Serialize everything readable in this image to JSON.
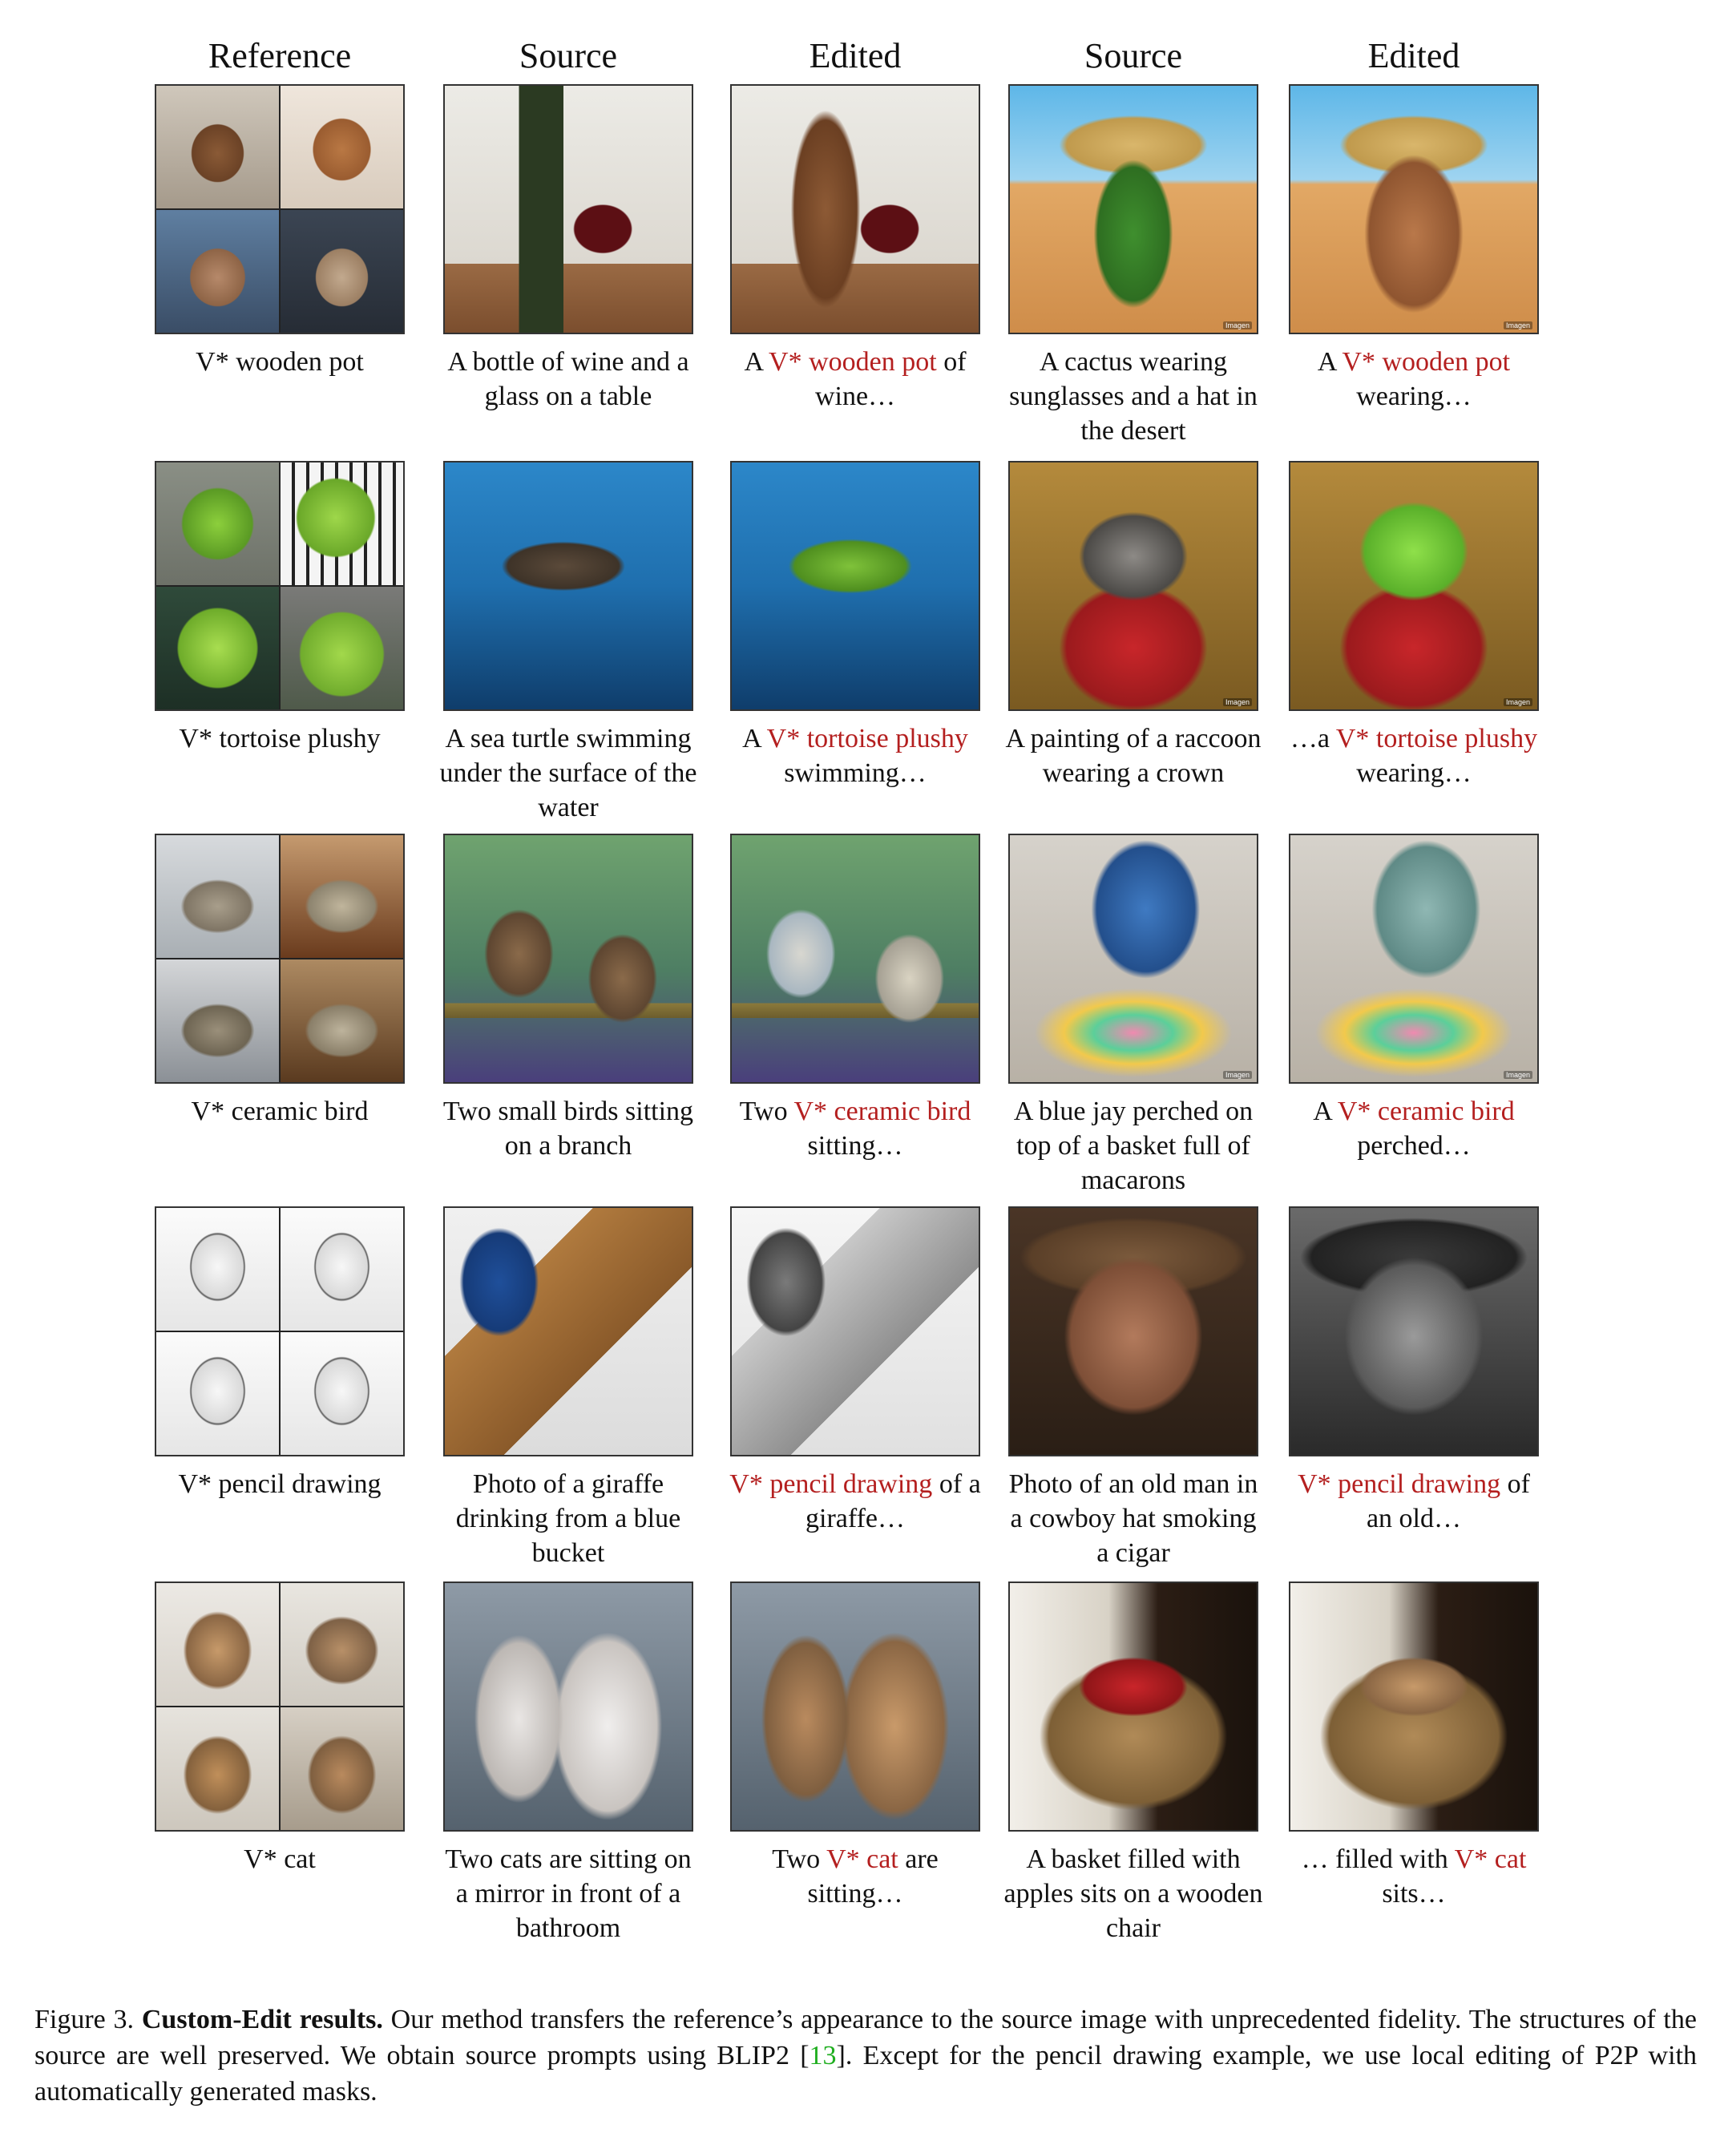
{
  "headers": {
    "reference": "Reference",
    "source_1": "Source",
    "edited_1": "Edited",
    "source_2": "Source",
    "edited_2": "Edited"
  },
  "watermark": "Imagen",
  "rows": [
    {
      "reference": "V* wooden pot",
      "source_1": "A bottle of wine and a glass on a table",
      "edited_1": {
        "pre": "A ",
        "concept": "V* wooden pot",
        "post": " of wine…"
      },
      "source_2": "A cactus wearing sunglasses and a hat in the desert",
      "edited_2": {
        "pre": "A ",
        "concept": "V* wooden pot",
        "post": " wearing…"
      }
    },
    {
      "reference": "V* tortoise plushy",
      "source_1": "A sea turtle swimming under the surface of the water",
      "edited_1": {
        "pre": "A ",
        "concept": "V* tortoise plushy",
        "post": " swimming…"
      },
      "source_2": "A painting of a raccoon wearing a crown",
      "edited_2": {
        "pre": "…a ",
        "concept": "V* tortoise plushy",
        "post": " wearing…"
      }
    },
    {
      "reference": "V* ceramic bird",
      "source_1": "Two small birds sitting on a branch",
      "edited_1": {
        "pre": "Two ",
        "concept": "V* ceramic bird",
        "post": " sitting…"
      },
      "source_2": "A blue jay perched on top of a basket full of macarons",
      "edited_2": {
        "pre": "A ",
        "concept": "V* ceramic bird",
        "post": " perched…"
      }
    },
    {
      "reference": "V* pencil drawing",
      "source_1": "Photo of a giraffe drinking from a blue bucket",
      "edited_1": {
        "pre": "",
        "concept": "V* pencil drawing",
        "post": " of a giraffe…"
      },
      "source_2": "Photo of an old man in a cowboy hat smoking a cigar",
      "edited_2": {
        "pre": "",
        "concept": "V* pencil drawing",
        "post": " of an old…"
      }
    },
    {
      "reference": "V* cat",
      "source_1": "Two cats are sitting on a mirror in front of a bathroom",
      "edited_1": {
        "pre": "Two ",
        "concept": "V* cat",
        "post": " are sitting…"
      },
      "source_2": "A basket filled with apples sits on a wooden chair",
      "edited_2": {
        "pre": "… filled with ",
        "concept": "V* cat",
        "post": " sits…"
      }
    }
  ],
  "caption": {
    "label": "Figure 3. ",
    "title": "Custom-Edit results.",
    "text_1": " Our method transfers the reference’s appearance to the source image with unprecedented fidelity. The structures of the source are well preserved. We obtain source prompts using BLIP2 [",
    "citation": "13",
    "text_2": "]. Except for the pencil drawing example, we use local editing of P2P with automatically generated masks."
  },
  "colors": {
    "concept_highlight": "#b41f1f",
    "citation": "#1fae1f"
  }
}
